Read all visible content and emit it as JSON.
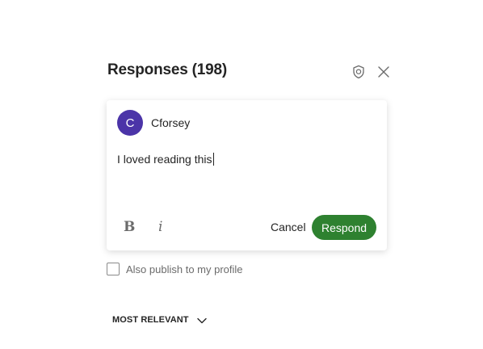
{
  "header": {
    "title": "Responses (198)",
    "shield_icon": "shield-icon",
    "close_icon": "close-icon"
  },
  "composer": {
    "avatar_initial": "C",
    "avatar_color": "#4b34a8",
    "username": "Cforsey",
    "text": "I loved reading this",
    "bold_label": "B",
    "italic_label": "i",
    "cancel_label": "Cancel",
    "respond_label": "Respond",
    "respond_color": "#2e8130"
  },
  "publish": {
    "label": "Also publish to my profile",
    "checked": false
  },
  "sort": {
    "label": "MOST RELEVANT",
    "icon": "chevron-down-icon"
  }
}
